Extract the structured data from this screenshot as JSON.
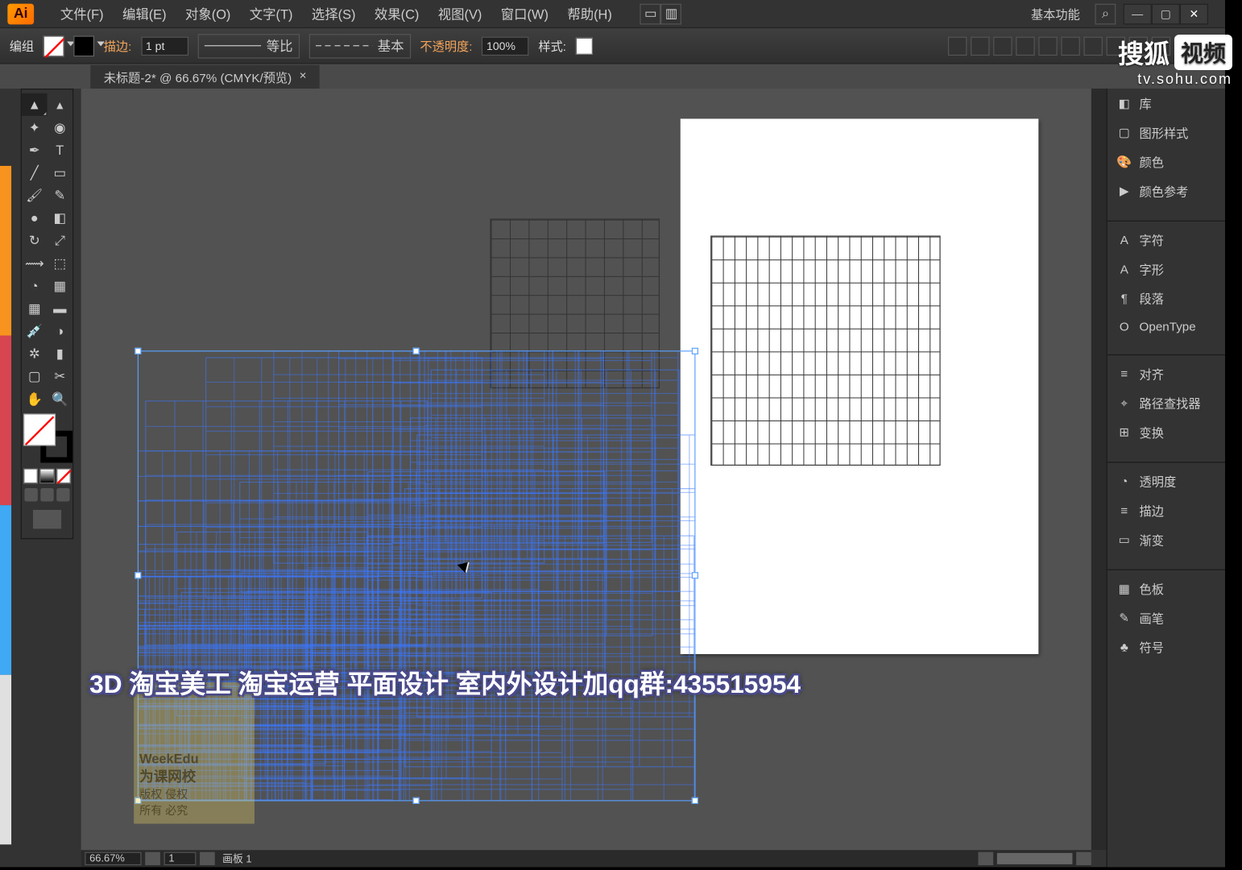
{
  "app_logo": "Ai",
  "menus": [
    "文件(F)",
    "编辑(E)",
    "对象(O)",
    "文字(T)",
    "选择(S)",
    "效果(C)",
    "视图(V)",
    "窗口(W)",
    "帮助(H)"
  ],
  "workspace_label": "基本功能",
  "control": {
    "object_label": "编组",
    "stroke_label": "描边:",
    "stroke_value": "1 pt",
    "uniform_label": "等比",
    "basic_label": "基本",
    "opacity_label": "不透明度:",
    "opacity_value": "100%",
    "style_label": "样式:"
  },
  "doc_tab": {
    "title": "未标题-2* @ 66.67% (CMYK/预览)"
  },
  "status": {
    "zoom": "66.67%",
    "artboard_nav": "1",
    "artboard_label": "画板 1"
  },
  "panels": [
    {
      "icon": "◧",
      "label": "库"
    },
    {
      "icon": "▢",
      "label": "图形样式"
    },
    {
      "icon": "🎨",
      "label": "颜色"
    },
    {
      "icon": "▶",
      "label": "颜色参考"
    },
    {
      "gap": true
    },
    {
      "icon": "A",
      "label": "字符"
    },
    {
      "icon": "A",
      "label": "字形"
    },
    {
      "icon": "¶",
      "label": "段落"
    },
    {
      "icon": "O",
      "label": "OpenType"
    },
    {
      "gap": true
    },
    {
      "icon": "≡",
      "label": "对齐"
    },
    {
      "icon": "⌖",
      "label": "路径查找器"
    },
    {
      "icon": "⊞",
      "label": "变换"
    },
    {
      "gap": true
    },
    {
      "icon": "◔",
      "label": "透明度"
    },
    {
      "icon": "≡",
      "label": "描边"
    },
    {
      "icon": "▭",
      "label": "渐变"
    },
    {
      "gap": true
    },
    {
      "icon": "▦",
      "label": "色板"
    },
    {
      "icon": "✎",
      "label": "画笔"
    },
    {
      "icon": "♣",
      "label": "符号"
    }
  ],
  "overlay_text": "3D 淘宝美工 淘宝运营 平面设计 室内外设计加qq群:435515954",
  "watermark": {
    "l1": "WeekEdu",
    "l2": "为课网校",
    "l3": "版权  侵权",
    "l4": "所有  必究"
  },
  "sohu": {
    "brand": "搜狐",
    "pill": "视频",
    "url": "tv.sohu.com"
  }
}
